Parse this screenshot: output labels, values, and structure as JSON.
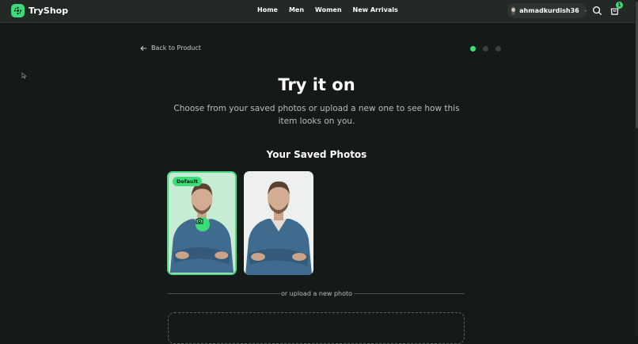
{
  "app": {
    "name": "TryShop",
    "accent": "#3ddc7a"
  },
  "nav": {
    "links": [
      "Home",
      "Men",
      "Women",
      "New Arrivals"
    ]
  },
  "user": {
    "name": "ahmadkurdish36"
  },
  "cart": {
    "count": "1"
  },
  "back_label": "Back to Product",
  "steps": {
    "total": 3,
    "current": 1
  },
  "hero": {
    "title": "Try it on",
    "subtitle": "Choose from your saved photos or upload a new one to see how this item looks on you."
  },
  "saved": {
    "title": "Your Saved Photos",
    "photos": [
      {
        "badge": "Default",
        "selected": true
      },
      {
        "selected": false
      }
    ]
  },
  "upload": {
    "divider": "or upload a new photo"
  },
  "icons": [
    "logo-icon",
    "user-avatar",
    "chevron-down-icon",
    "search-icon",
    "cart-icon",
    "arrow-left-icon",
    "camera-icon",
    "cursor-icon"
  ]
}
